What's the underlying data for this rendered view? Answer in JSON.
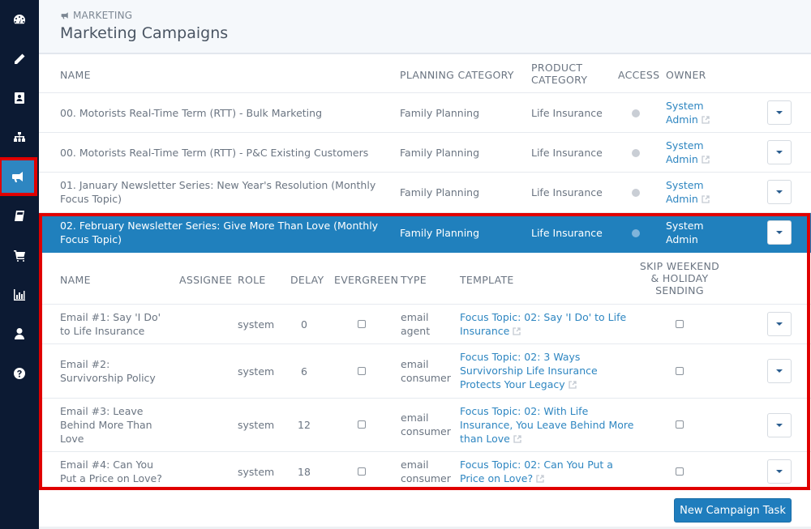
{
  "sidebar": {
    "items": [
      {
        "icon": "dashboard-icon",
        "label": "Dashboard"
      },
      {
        "icon": "pencil-icon",
        "label": "Edit"
      },
      {
        "icon": "contacts-icon",
        "label": "Contacts"
      },
      {
        "icon": "org-chart-icon",
        "label": "Organization"
      },
      {
        "icon": "megaphone-icon",
        "label": "Marketing",
        "active": true
      },
      {
        "icon": "book-icon",
        "label": "Library"
      },
      {
        "icon": "cart-icon",
        "label": "Store"
      },
      {
        "icon": "bar-chart-icon",
        "label": "Reports"
      },
      {
        "icon": "user-icon",
        "label": "Profile"
      },
      {
        "icon": "help-icon",
        "label": "Help"
      }
    ]
  },
  "header": {
    "breadcrumb": "MARKETING",
    "title": "Marketing Campaigns"
  },
  "campaigns_table": {
    "columns": [
      "NAME",
      "PLANNING CATEGORY",
      "PRODUCT CATEGORY",
      "ACCESS",
      "OWNER"
    ],
    "product_category_header_line1": "PRODUCT",
    "product_category_header_line2": "CATEGORY",
    "rows": [
      {
        "name": "00. Motorists Real-Time Term (RTT) - Bulk Marketing",
        "planning_category": "Family Planning",
        "product_category": "Life Insurance",
        "access": "public",
        "owner_line1": "System",
        "owner_line2": "Admin"
      },
      {
        "name": "00. Motorists Real-Time Term (RTT) - P&C Existing Customers",
        "planning_category": "Family Planning",
        "product_category": "Life Insurance",
        "access": "public",
        "owner_line1": "System",
        "owner_line2": "Admin"
      },
      {
        "name_line1": "01. January Newsletter Series: New Year's Resolution (Monthly",
        "name_line2": "Focus Topic)",
        "planning_category": "Family Planning",
        "product_category": "Life Insurance",
        "access": "public",
        "owner_line1": "System",
        "owner_line2": "Admin"
      },
      {
        "name_line1": "02. February Newsletter Series: Give More Than Love (Monthly",
        "name_line2": "Focus Topic)",
        "planning_category": "Family Planning",
        "product_category": "Life Insurance",
        "access": "public",
        "owner_line1": "System",
        "owner_line2": "Admin",
        "selected": true
      }
    ]
  },
  "tasks_table": {
    "columns": {
      "name": "NAME",
      "assignee": "ASSIGNEE",
      "role": "ROLE",
      "delay": "DELAY",
      "evergreen": "EVERGREEN",
      "type": "TYPE",
      "template": "TEMPLATE",
      "skip_line1": "SKIP WEEKEND",
      "skip_line2": "& HOLIDAY",
      "skip_line3": "SENDING"
    },
    "rows": [
      {
        "name": [
          "Email #1: Say 'I Do'",
          "to Life Insurance"
        ],
        "assignee": "",
        "role": "system",
        "delay": "0",
        "evergreen": false,
        "type": [
          "email",
          "agent"
        ],
        "template": [
          "Focus Topic: 02: Say 'I Do' to Life",
          "Insurance"
        ],
        "skip_weekend": false
      },
      {
        "name": [
          "Email #2:",
          "Survivorship Policy"
        ],
        "assignee": "",
        "role": "system",
        "delay": "6",
        "evergreen": false,
        "type": [
          "email",
          "consumer"
        ],
        "template": [
          "Focus Topic: 02: 3 Ways",
          "Survivorship Life Insurance",
          "Protects Your Legacy"
        ],
        "skip_weekend": false
      },
      {
        "name": [
          "Email #3: Leave",
          "Behind More Than",
          "Love"
        ],
        "assignee": "",
        "role": "system",
        "delay": "12",
        "evergreen": false,
        "type": [
          "email",
          "consumer"
        ],
        "template": [
          "Focus Topic: 02: With Life",
          "Insurance, You Leave Behind More",
          "than Love"
        ],
        "skip_weekend": false
      },
      {
        "name": [
          "Email #4: Can You",
          "Put a Price on Love?"
        ],
        "assignee": "",
        "role": "system",
        "delay": "18",
        "evergreen": false,
        "type": [
          "email",
          "consumer"
        ],
        "template": [
          "Focus Topic: 02: Can You Put a",
          "Price on Love?"
        ],
        "skip_weekend": false
      }
    ]
  },
  "actions": {
    "new_campaign_task": "New Campaign Task"
  },
  "colors": {
    "sidebar_bg": "#0c1a33",
    "accent": "#2e86c1",
    "selected_row": "#2080bd",
    "highlight": "#e00000"
  }
}
